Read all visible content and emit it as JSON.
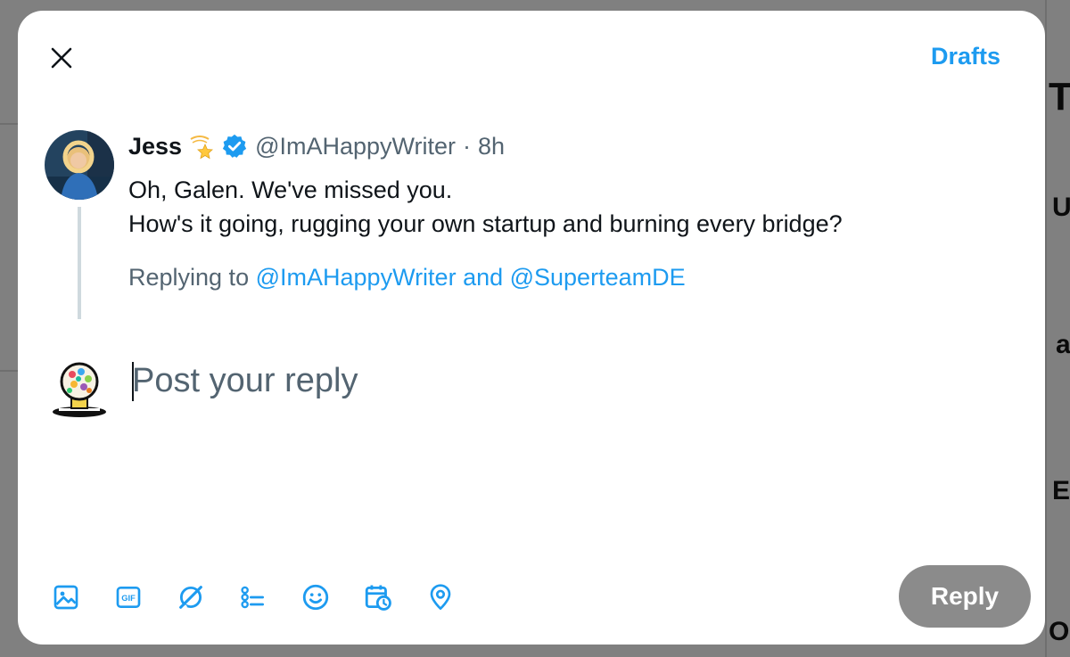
{
  "header": {
    "close_icon": "close-icon",
    "drafts_label": "Drafts"
  },
  "original_post": {
    "name": "Jess",
    "badge_emoji": "💫",
    "verified_icon": "verified-badge-icon",
    "handle": "@ImAHappyWriter",
    "separator": "·",
    "time": "8h",
    "lines": [
      "Oh, Galen. We've missed you.",
      "How's it going, rugging your own startup and burning every bridge?"
    ],
    "replying_prefix": "Replying to",
    "replying_mentions": "@ImAHappyWriter and @SuperteamDE"
  },
  "composer": {
    "placeholder": "Post your reply",
    "value": ""
  },
  "toolbar": {
    "items": [
      {
        "icon": "image-icon"
      },
      {
        "icon": "gif-icon"
      },
      {
        "icon": "grok-icon"
      },
      {
        "icon": "poll-icon"
      },
      {
        "icon": "emoji-icon"
      },
      {
        "icon": "schedule-icon"
      },
      {
        "icon": "location-icon"
      }
    ],
    "gif_label": "GIF",
    "reply_label": "Reply"
  },
  "colors": {
    "accent": "#1d9bf0",
    "text": "#0f1419",
    "secondary": "#536471",
    "reply_disabled": "#8b8b8b"
  }
}
